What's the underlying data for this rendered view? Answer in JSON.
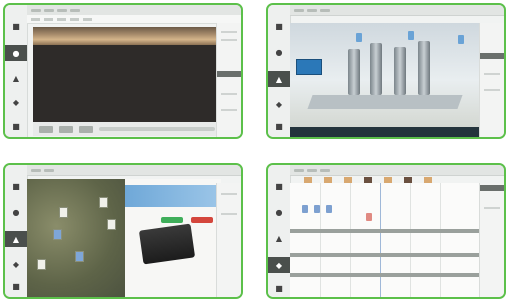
{
  "screens": [
    {
      "id": "timeline-editor",
      "sidebar_active": 2
    },
    {
      "id": "plant-3d-view",
      "sidebar_active": 2
    },
    {
      "id": "map-and-detail",
      "sidebar_active": 3
    },
    {
      "id": "schedule-grid",
      "sidebar_active": 4
    }
  ],
  "colors": {
    "card_border": "#5cc04a",
    "sidebar_active": "#4a4f4c",
    "accent_blue": "#2b78b8",
    "accent_green": "#3fae5a",
    "accent_red": "#d4463c"
  },
  "icons": {
    "sidebar": [
      "folder-icon",
      "camera-icon",
      "layers-icon",
      "settings-icon",
      "home-icon"
    ]
  }
}
